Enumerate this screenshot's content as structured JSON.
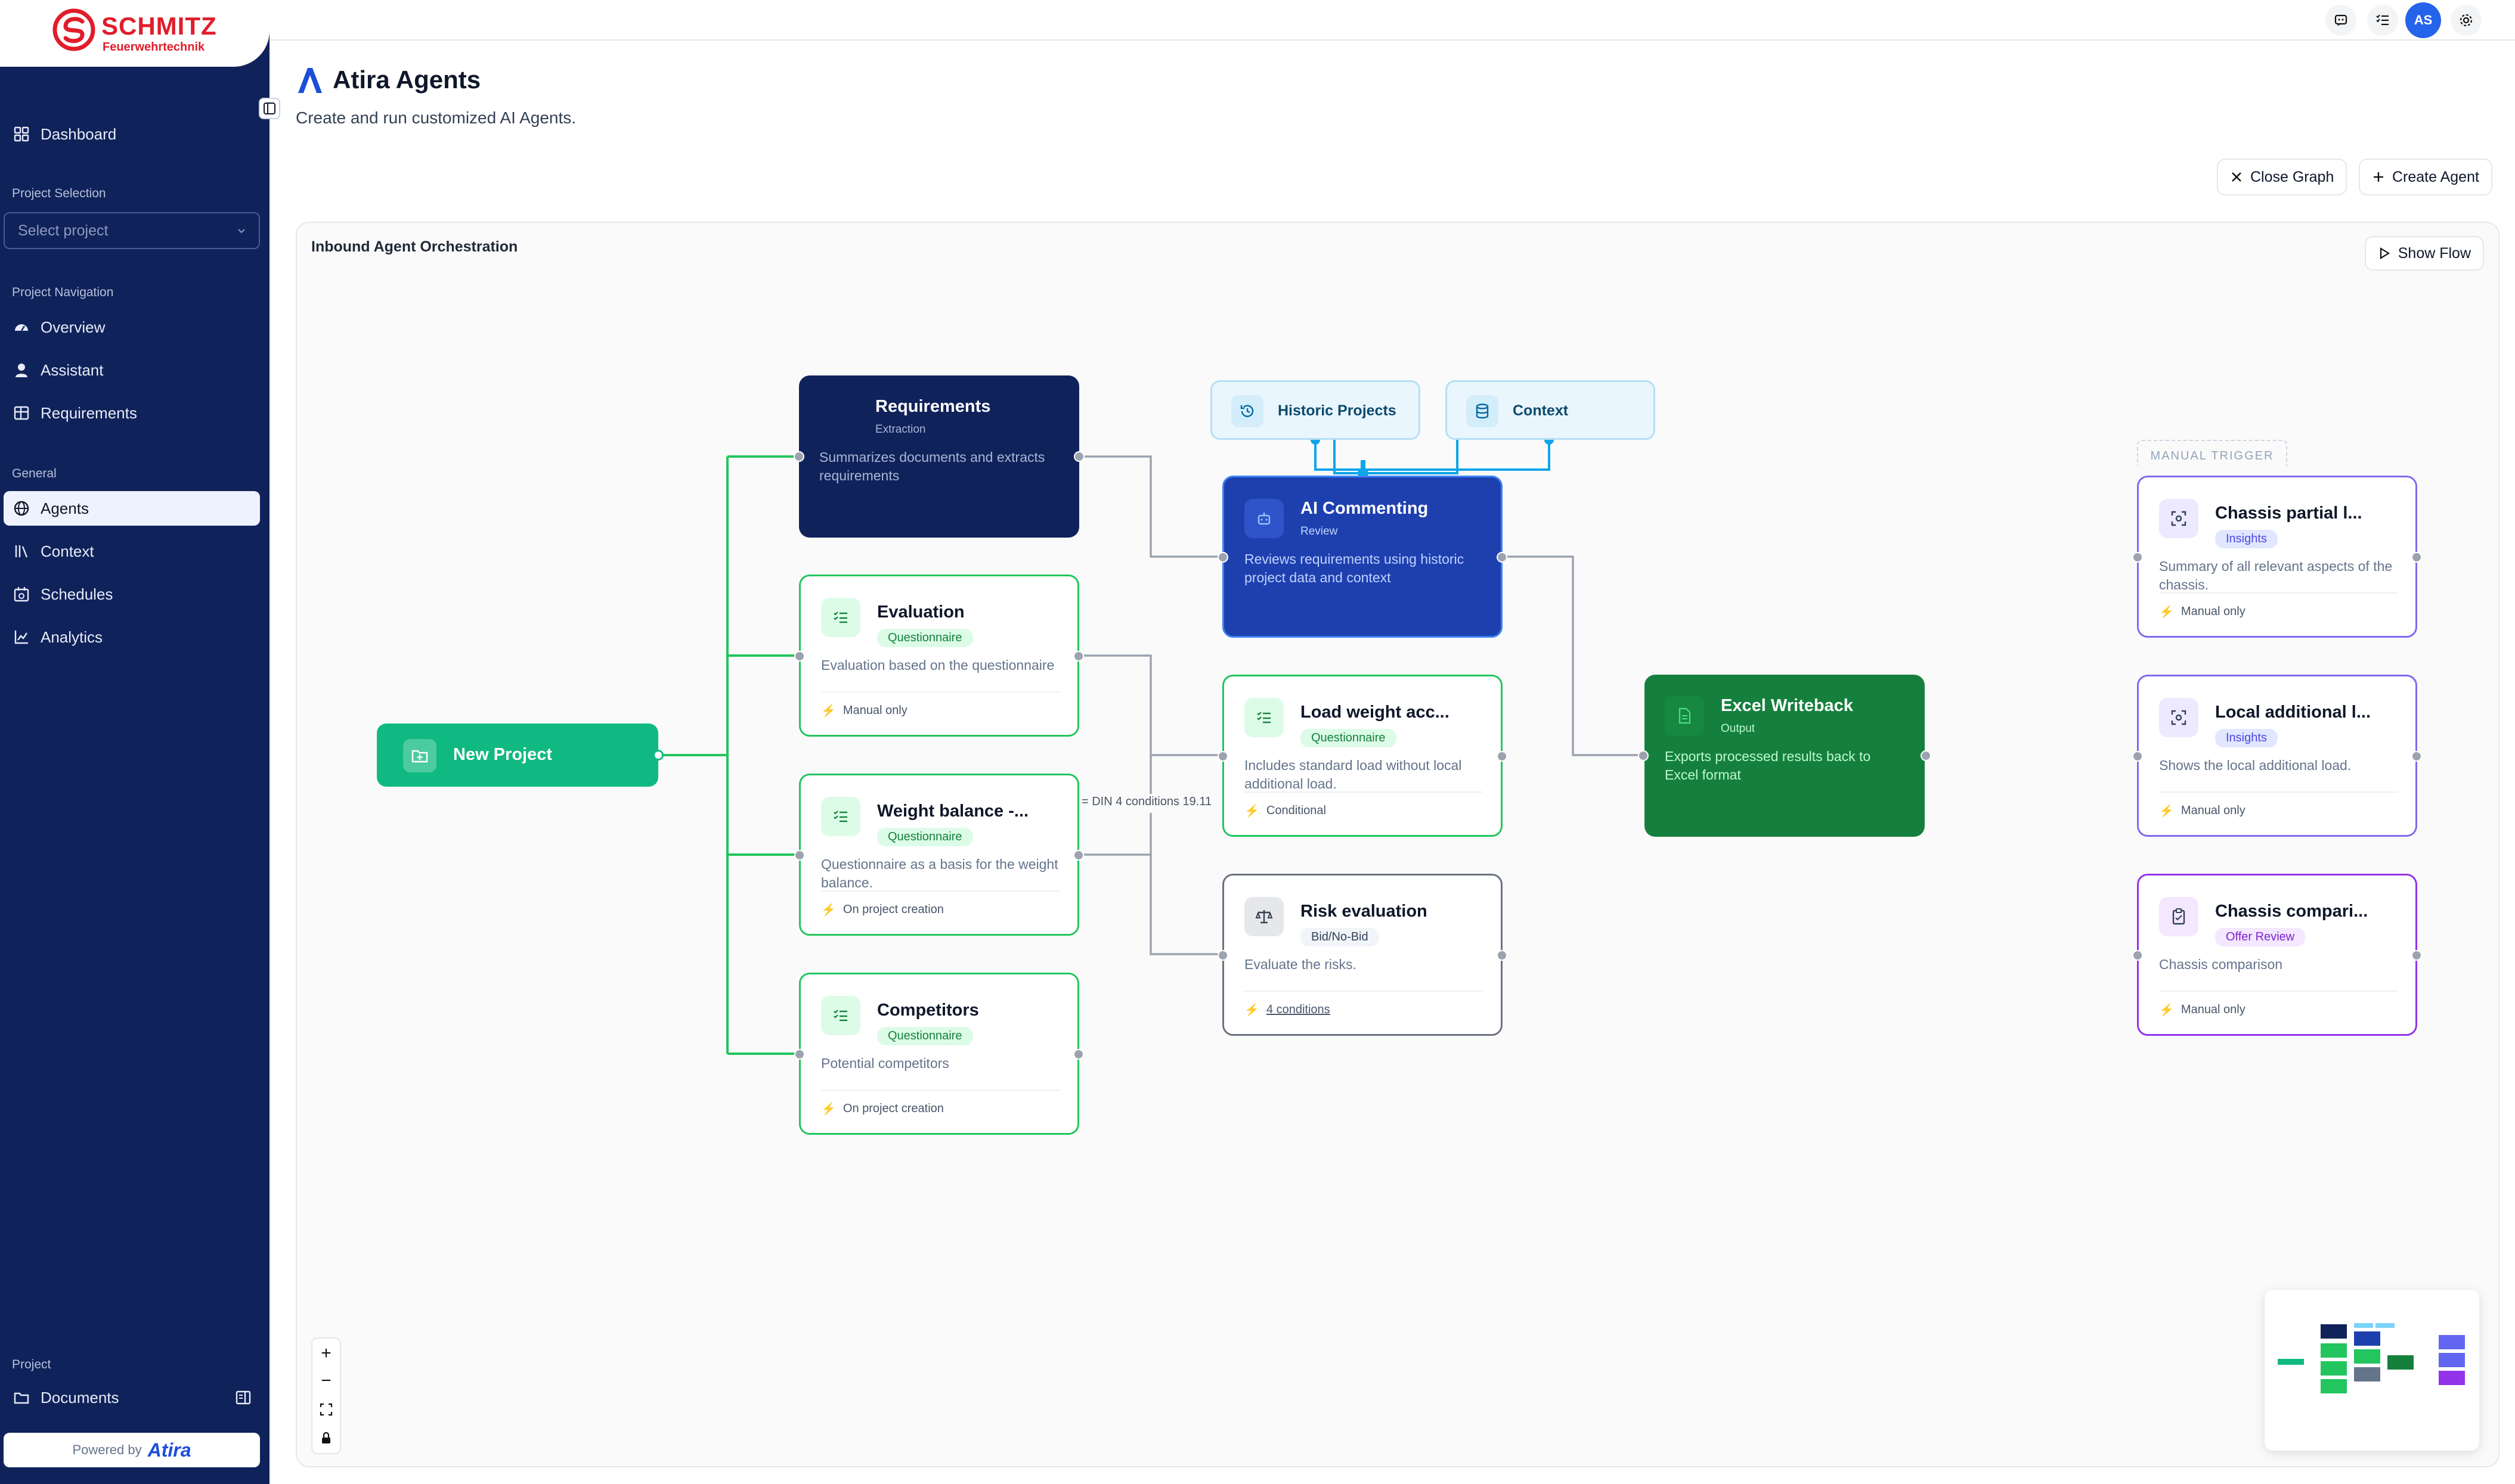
{
  "brand": {
    "name": "SCHMITZ",
    "subtitle": "Feuerwehrtechnik",
    "brand_color": "#e11d2a"
  },
  "sidebar": {
    "dashboard_label": "Dashboard",
    "project_selection_label": "Project Selection",
    "project_select_placeholder": "Select project",
    "project_navigation_label": "Project Navigation",
    "project_nav": [
      {
        "label": "Overview",
        "icon": "gauge-icon"
      },
      {
        "label": "Assistant",
        "icon": "user-icon"
      },
      {
        "label": "Requirements",
        "icon": "table-icon"
      }
    ],
    "general_label": "General",
    "general_nav": [
      {
        "label": "Agents",
        "icon": "globe-icon",
        "active": true
      },
      {
        "label": "Context",
        "icon": "library-icon"
      },
      {
        "label": "Schedules",
        "icon": "calendar-icon"
      },
      {
        "label": "Analytics",
        "icon": "chart-icon"
      }
    ],
    "project_label": "Project",
    "documents_label": "Documents",
    "powered_by": "Powered by",
    "powered_brand": "Atira"
  },
  "topbar": {
    "icons": [
      "chat-icon",
      "checklist-icon",
      "settings-icon"
    ],
    "avatar_initials": "AS",
    "avatar_color": "#2563eb"
  },
  "header": {
    "title": "Atira Agents",
    "subtitle": "Create and run customized AI Agents.",
    "close_graph_label": "Close Graph",
    "create_agent_label": "Create Agent"
  },
  "graph": {
    "title": "Inbound Agent Orchestration",
    "show_flow_label": "Show Flow",
    "edge_label": "= DIN 4 conditions 19.11",
    "manual_trigger_label": "MANUAL TRIGGER",
    "nodes": {
      "new_project": {
        "title": "New Project"
      },
      "requirements": {
        "title": "Requirements",
        "badge": "Extraction",
        "desc": "Summarizes documents and extracts requirements"
      },
      "evaluation": {
        "title": "Evaluation",
        "badge": "Questionnaire",
        "desc": "Evaluation based on the questionnaire",
        "footer": "Manual only"
      },
      "weight_balance": {
        "title": "Weight balance -...",
        "badge": "Questionnaire",
        "desc": "Questionnaire as a basis for the weight balance.",
        "footer": "On project creation"
      },
      "competitors": {
        "title": "Competitors",
        "badge": "Questionnaire",
        "desc": "Potential competitors",
        "footer": "On project creation"
      },
      "historic_projects": {
        "title": "Historic Projects"
      },
      "context": {
        "title": "Context"
      },
      "ai_commenting": {
        "title": "AI Commenting",
        "badge": "Review",
        "desc": "Reviews requirements using historic project data and context"
      },
      "load_weight": {
        "title": "Load weight acc...",
        "badge": "Questionnaire",
        "desc": "Includes standard load without local additional load.",
        "footer": "Conditional"
      },
      "risk_evaluation": {
        "title": "Risk evaluation",
        "badge": "Bid/No-Bid",
        "desc": "Evaluate the risks.",
        "footer": "4 conditions"
      },
      "excel_writeback": {
        "title": "Excel Writeback",
        "badge": "Output",
        "desc": "Exports processed results back to Excel format"
      },
      "chassis_partial": {
        "title": "Chassis partial l...",
        "badge": "Insights",
        "desc": "Summary of all relevant aspects of the chassis.",
        "footer": "Manual only"
      },
      "local_additional": {
        "title": "Local additional l...",
        "badge": "Insights",
        "desc": "Shows the local additional load.",
        "footer": "Manual only"
      },
      "chassis_comparison": {
        "title": "Chassis compari...",
        "badge": "Offer Review",
        "desc": "Chassis comparison",
        "footer": "Manual only"
      }
    }
  },
  "colors": {
    "sidebar_bg": "#10225a",
    "green_edge": "#22c55e",
    "blue_edge": "#0ea5e9",
    "node_navy": "#10225a",
    "node_blue": "#1e40af",
    "node_green": "#15803d",
    "new_project_green": "#10b981",
    "insights_purple": "#7c6cf0",
    "offer_purple": "#9333ea"
  }
}
